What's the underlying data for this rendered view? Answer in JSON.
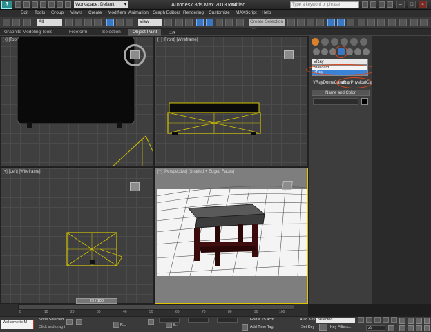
{
  "title_bar": {
    "workspace": "Workspace: Default",
    "app_title": "Autodesk 3ds Max  2013 x64",
    "doc_title": "Untitled",
    "search_placeholder": "Type a keyword or phrase",
    "logo_text": "3"
  },
  "menu": [
    "Edit",
    "Tools",
    "Group",
    "Views",
    "Create",
    "Modifiers",
    "Animation",
    "Graph Editors",
    "Rendering",
    "Customize",
    "MAXScript",
    "Help"
  ],
  "toolbar": {
    "selection_filter": "All",
    "coord_system": "View",
    "named_selection": "Create Selection Set"
  },
  "ribbon_tabs": [
    "Graphite Modeling Tools",
    "Freeform",
    "Selection",
    "Object Paint"
  ],
  "viewports": {
    "top": "[+] [Top] [Wireframe]",
    "front": "[+] [Front] [Wireframe]",
    "left": "[+] [Left] [Wireframe]",
    "perspective": "[+] [Perspective] [Shaded + Edged Faces]"
  },
  "command_panel": {
    "category_dropdown": "VRay",
    "options": [
      "Standard",
      "VRay"
    ],
    "selected_option": "VRay",
    "object_btn_1": "VRayDomeCamera",
    "object_btn_2": "VRayPhysicalCamera",
    "rollout_title": "Name and Color",
    "object_color": "#000000"
  },
  "timeline": {
    "frame_counter": "29 / 100",
    "ticks": [
      "0",
      "10",
      "20",
      "30",
      "40",
      "50",
      "60",
      "70",
      "80",
      "90",
      "100"
    ]
  },
  "status_bar": {
    "listener_text": "Welcome to M",
    "selection_status": "None Selected",
    "prompt": "Click and drag to select and move objects",
    "taskbar_1": "R...",
    "taskbar_2": "E...",
    "grid": "Grid = 25.4cm",
    "add_time_tag": "Add Time Tag",
    "auto_key": "Auto Key",
    "set_key": "Set Key",
    "key_mode": "Selected",
    "key_filters": "Key Filters...",
    "frame": "29"
  },
  "colors": {
    "accent_highlight": "#e04a1c",
    "active_viewport": "#e0c200",
    "selection_blue": "#3b83d6"
  }
}
